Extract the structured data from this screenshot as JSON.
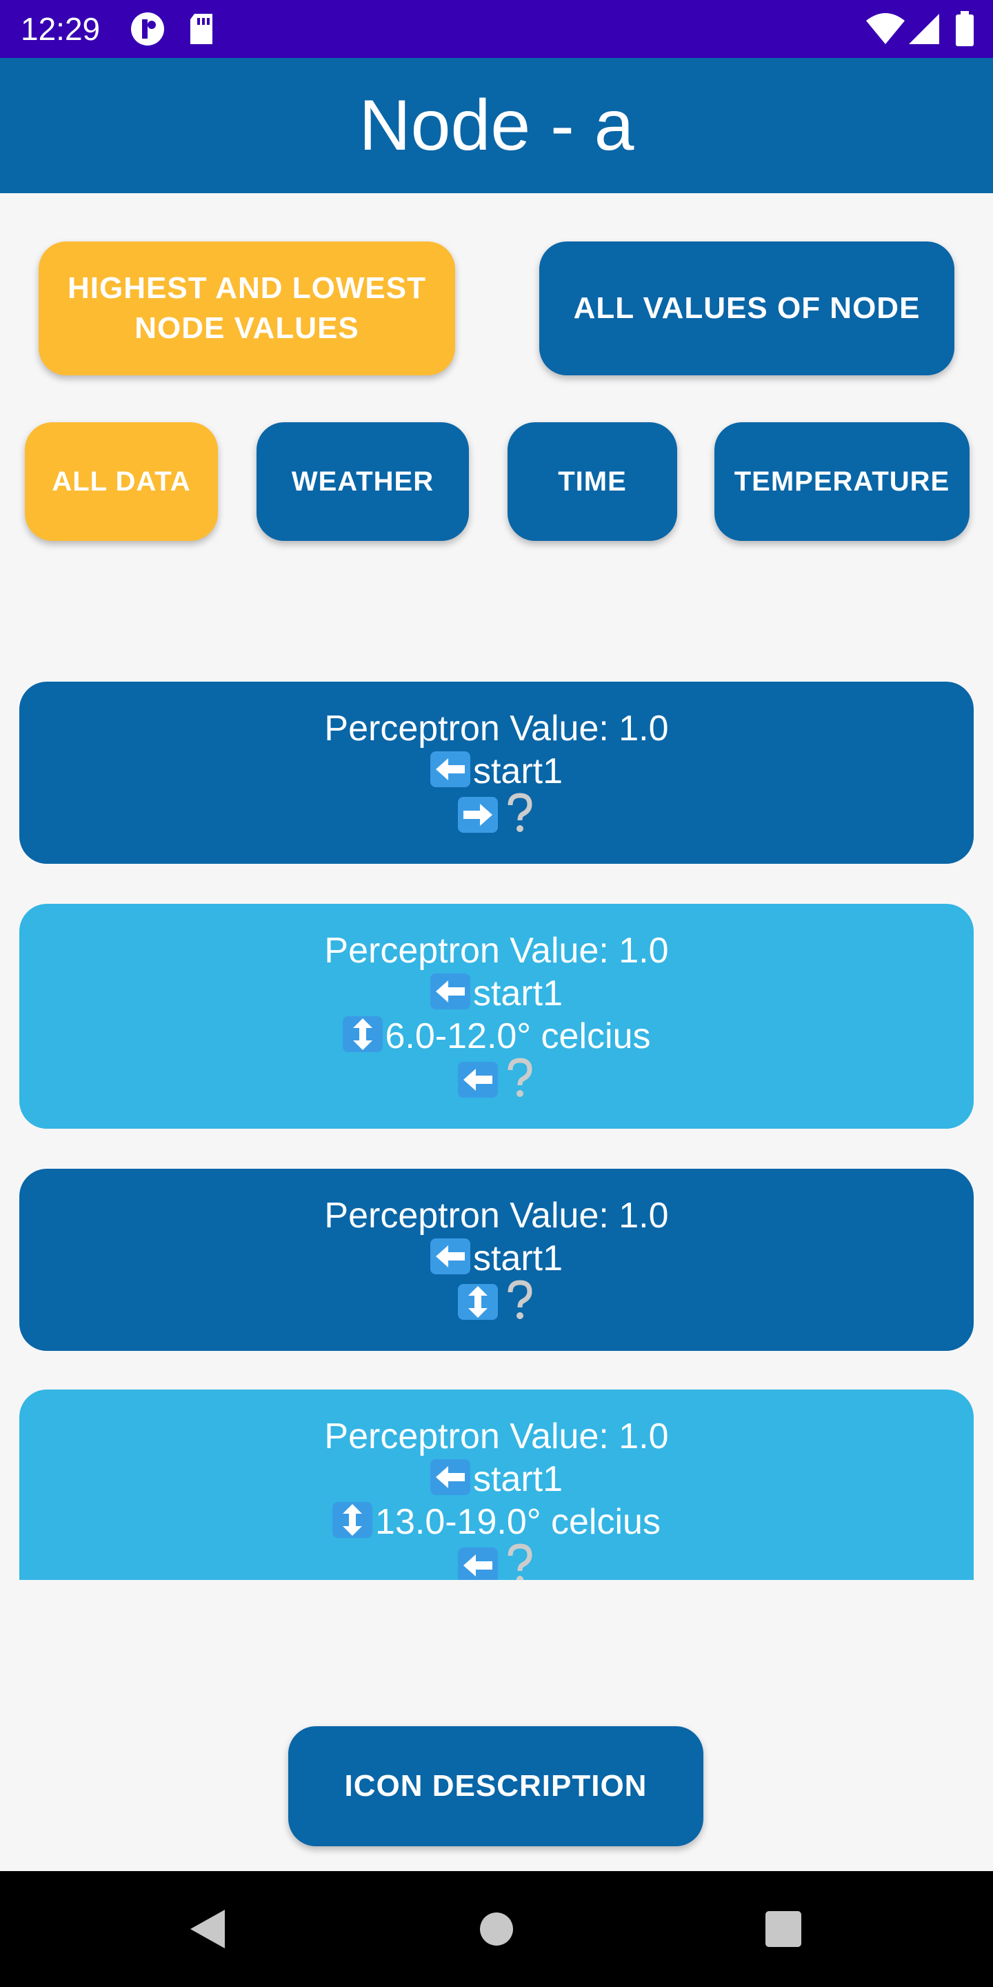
{
  "status_bar": {
    "time": "12:29",
    "background": "#3700b3",
    "icons": [
      "notification-circle-icon",
      "sd-card-icon",
      "wifi-icon",
      "cell-signal-icon",
      "battery-icon"
    ]
  },
  "app_bar": {
    "title": "Node - a",
    "background": "#0966a7"
  },
  "top_buttons": {
    "highest_lowest": "HIGHEST AND LOWEST NODE VALUES",
    "all_values": "ALL VALUES OF NODE"
  },
  "filter_buttons": {
    "all_data": "ALL DATA",
    "weather": "WEATHER",
    "time": "TIME",
    "temperature": "TEMPERATURE"
  },
  "colors": {
    "active": "#fdbb32",
    "primary": "#0966a7",
    "card_light": "#34b5e4"
  },
  "cards": [
    {
      "value": "Perceptron Value: 1.0",
      "start": "start1",
      "detail": "",
      "last_icon": "right-arrow-icon"
    },
    {
      "value": "Perceptron Value: 1.0",
      "start": "start1",
      "detail": "6.0-12.0° celcius",
      "last_icon": "left-arrow-icon"
    },
    {
      "value": "Perceptron Value: 1.0",
      "start": "start1",
      "detail": "",
      "last_icon": "up-down-arrow-icon"
    },
    {
      "value": "Perceptron Value: 1.0",
      "start": "start1",
      "detail": "13.0-19.0° celcius",
      "last_icon": "left-arrow-icon"
    }
  ],
  "bottom_button": {
    "label": "ICON DESCRIPTION"
  },
  "nav_bar": {
    "icons": [
      "back-icon",
      "home-icon",
      "recents-icon"
    ]
  }
}
